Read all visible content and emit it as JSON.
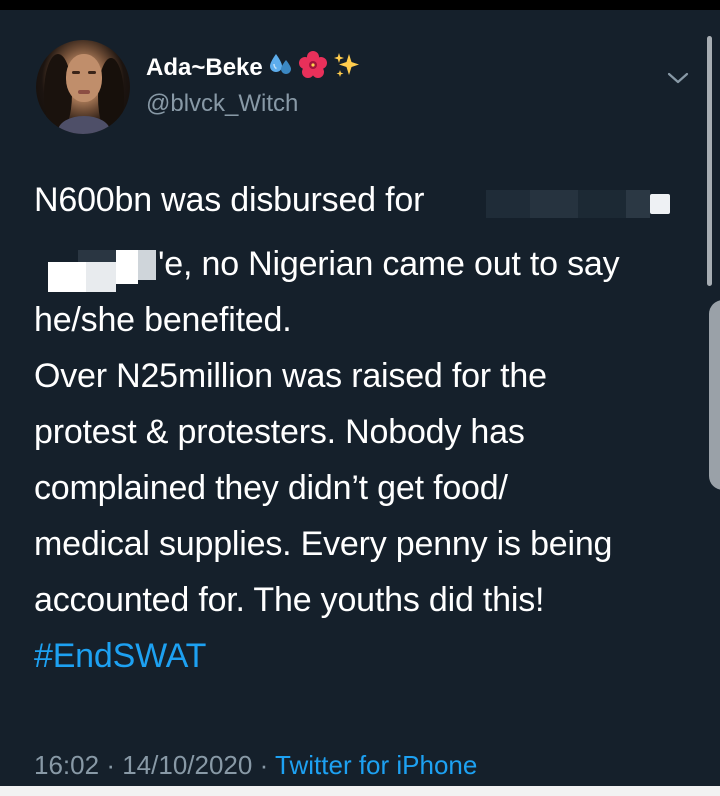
{
  "tweet": {
    "display_name": "Ada~Beke",
    "emojis": [
      "droplets-icon",
      "hibiscus-icon",
      "sparkles-icon"
    ],
    "handle": "@blvck_Witch",
    "text_lines": [
      "N600bn was disbursed for",
      "'e, no Nigerian came out to say",
      "he/she benefited.",
      "Over N25million was raised for the",
      "protest & protesters. Nobody has",
      "complained they didn’t get food/",
      "medical supplies. Every penny is being",
      "accounted for. The youths did this!"
    ],
    "hashtag": "#EndSWAT",
    "time": "16:02",
    "date": "14/10/2020",
    "separator": "·",
    "source": "Twitter for iPhone"
  },
  "colors": {
    "background": "#15202b",
    "text": "#ffffff",
    "secondary": "#8899a6",
    "link": "#1da1f2"
  }
}
